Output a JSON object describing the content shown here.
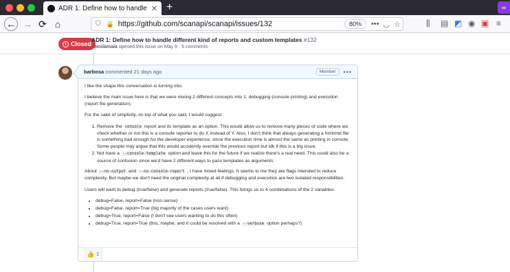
{
  "browser": {
    "tab_title": "ADR 1: Define how to handle di",
    "url": "https://github.com/scanapi/scanapi/issues/132",
    "zoom": "80%",
    "colors": {
      "close": "#ff5f57",
      "minimize": "#febc2e",
      "maximize": "#28c840"
    }
  },
  "issue": {
    "state": "Closed",
    "title": "ADR 1: Define how to handle different kind of reports and custom templates",
    "number": "#132",
    "author": "camilamaia",
    "meta_rest": "opened this issue on May 9 · 5 comments"
  },
  "comment": {
    "author": "barbosa",
    "action": "commented 21 days ago",
    "role_badge": "Member",
    "p1": "I like the shape this conversation is turning into.",
    "p2": "I believe the main issue here is that we were mixing 2 different concepts into 1: debugging (console printing) and execution (report file generation).",
    "p3": "For the sake of simplicity, on top of what you said, I would suggest:",
    "ol": [
      {
        "pre": "Remove the ",
        "code": "console",
        "post": " report and its template as an option. This would allow us to remove many pieces of code where we check whether or not this is a console reporter to do X instead of Y. Also, I don't think that always generating a html/md file is something bad enough for the developer experience, since the execution time is almost the same as printing in console. Some people may argue that this would accidently override the previous report but idk if this is a big issue."
      },
      {
        "pre": "Not have a ",
        "code": "--console-template",
        "post": " option and leave this for the future if we realize there's a real need. This could also be a source of confusion since we'd have 2 different ways to pass templates as arguments"
      }
    ],
    "p4": {
      "pre": "About ",
      "code1": "--no-output",
      "mid": " and ",
      "code2": "--no-console-report",
      "post": " , I have mixed feelings. It seems to me they are flags intended to reduce complexity. But maybe we don't need the original complexity at all if debugging and execution are two isolated responsibilities."
    },
    "p5": "Users will want to debug (true/false) and generate reports (true/false). This brings us to 4 combinations of the 2 variables:",
    "ul": [
      {
        "text": "debug=False, report=False (non sense)"
      },
      {
        "text": "debug=False, report=True (big majority of the cases users want)"
      },
      {
        "text": "debug=True, report=False (I don't see users wanting to do this often)"
      },
      {
        "pre": "debug=True, report=True (this, maybe, and it could be resolved with a ",
        "code": "--verbose",
        "post": " option perhaps?)"
      }
    ],
    "reaction_count": "1"
  }
}
